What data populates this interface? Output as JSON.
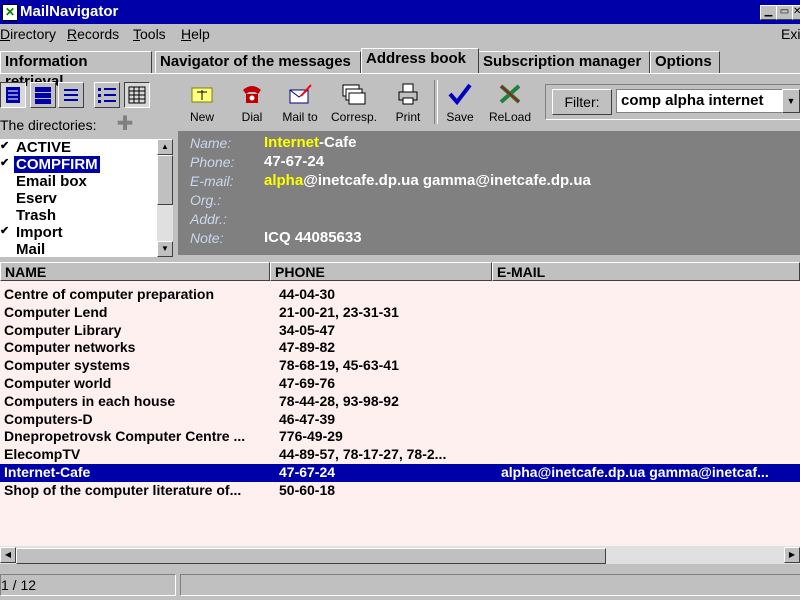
{
  "window": {
    "title": "MailNavigator"
  },
  "menu": [
    {
      "label": "Directory",
      "u": "D"
    },
    {
      "label": "Records",
      "u": "R"
    },
    {
      "label": "Tools",
      "u": "T"
    },
    {
      "label": "Help",
      "u": "H"
    },
    {
      "label": "Exi",
      "u": ""
    }
  ],
  "tabs": [
    "Information retrieval",
    "Navigator of the messages",
    "Address book",
    "Subscription manager",
    "Options"
  ],
  "active_tab": "Address book",
  "directories": {
    "label": "The directories:",
    "items": [
      {
        "label": "ACTIVE",
        "checked": true
      },
      {
        "label": "COMPFIRM",
        "checked": true,
        "selected": true
      },
      {
        "label": "Email box",
        "checked": false
      },
      {
        "label": "Eserv",
        "checked": false
      },
      {
        "label": "Trash",
        "checked": false
      },
      {
        "label": "Import",
        "checked": true
      },
      {
        "label": "Mail",
        "checked": false
      }
    ]
  },
  "toolbar": {
    "new": "New",
    "dial": "Dial",
    "mailto": "Mail to",
    "corresp": "Corresp.",
    "print": "Print",
    "save": "Save",
    "reload": "ReLoad"
  },
  "filter": {
    "label": "Filter:",
    "value": "comp alpha internet"
  },
  "detail": {
    "name_label": "Name:",
    "name_hl": "Internet",
    "name_rest": "-Cafe",
    "phone_label": "Phone:",
    "phone": "47-67-24",
    "email_label": "E-mail:",
    "email_hl": "alpha",
    "email_rest": "@inetcafe.dp.ua gamma@inetcafe.dp.ua",
    "org_label": "Org.:",
    "addr_label": "Addr.:",
    "note_label": "Note:",
    "note": "ICQ 44085633"
  },
  "table": {
    "headers": [
      "NAME",
      "PHONE",
      "E-MAIL"
    ],
    "rows": [
      [
        "Centre of computer preparation",
        "44-04-30",
        ""
      ],
      [
        "Computer Lend",
        "21-00-21, 23-31-31",
        ""
      ],
      [
        "Computer Library",
        "34-05-47",
        ""
      ],
      [
        "Computer networks",
        "47-89-82",
        ""
      ],
      [
        "Computer systems",
        "78-68-19, 45-63-41",
        ""
      ],
      [
        "Computer world",
        "47-69-76",
        ""
      ],
      [
        "Computers in each house",
        "78-44-28, 93-98-92",
        ""
      ],
      [
        "Computers-D",
        "46-47-39",
        ""
      ],
      [
        "Dnepropetrovsk Computer Centre ...",
        "776-49-29",
        ""
      ],
      [
        "ElecompTV",
        "44-89-57, 78-17-27, 78-2...",
        ""
      ],
      [
        "Internet-Cafe",
        "47-67-24",
        "alpha@inetcafe.dp.ua gamma@inetcaf..."
      ],
      [
        "Shop of the computer literature of...",
        "50-60-18",
        ""
      ]
    ],
    "selected_index": 10
  },
  "status": {
    "record": "1 / 12"
  },
  "colors": {
    "titlebar": "#0000a8",
    "selection": "#0000a8",
    "highlight": "#ffff00",
    "grid_bg": "#fff0f0"
  }
}
